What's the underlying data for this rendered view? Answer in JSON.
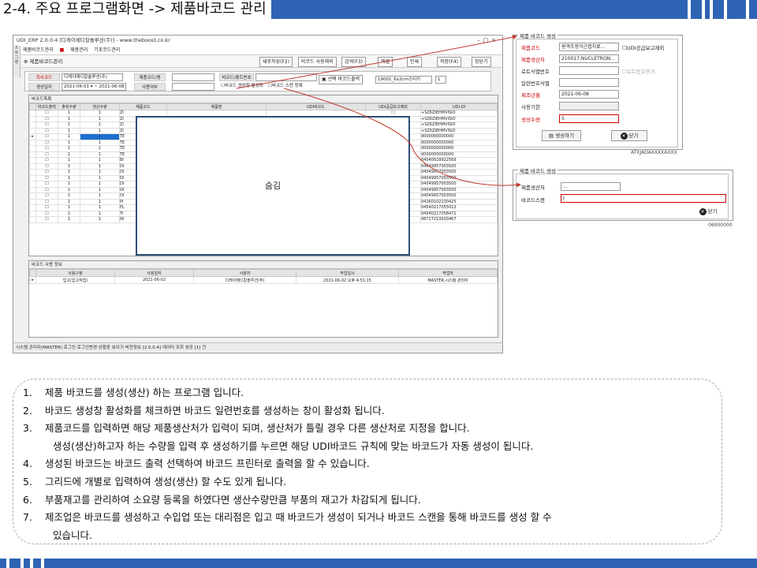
{
  "slide": {
    "title": "2-4. 주요 프로그램화면 -> 제품바코드 관리"
  },
  "window": {
    "title": "UDI_ERP 2.0.0.4 [디케이메디칼솔루션(주)] - www.theboost.co.kr",
    "menu": [
      "제품바코드관리",
      "제품관리",
      "기초코드관리"
    ],
    "side_tab": "프로그램",
    "page_title": "제품바코드관리",
    "toolbar": [
      "새로작성(F2)",
      "바코드 사용제외",
      "검색(F3)",
      "엑셀",
      "인쇄",
      "저장(F4)",
      "창닫기"
    ],
    "form": {
      "company_label": "회사코드",
      "company_value": "디케이메디칼솔루션(주)",
      "product_label": "제품코드/명",
      "barcode_label": "바코드/롯트번호",
      "date_label": "생성일자",
      "date_value": "2021-06-01 ▾ ~ 2021-06-08 ▾",
      "use_label": "사용여부",
      "chk1": "바코드 생성창 활성화",
      "chk2": "바코드 스캔 등록",
      "print_label": "선택 바코드출력",
      "print_value": "19001_6x2cm스티커",
      "print_count": "1"
    },
    "grid": {
      "caption": "바코드목록",
      "headers": [
        "",
        "바코드출력",
        "출력수량",
        "생산수량",
        "제품코드",
        "제품명",
        "UDI바코드",
        "UDI공급보고제외",
        "UDI-DI"
      ],
      "rows": [
        [
          "1",
          "1",
          "ZI",
          "+SZ6ZIEHMVISIO"
        ],
        [
          "1",
          "1",
          "ZI",
          "+SZ6ZIEHMVISIO"
        ],
        [
          "1",
          "1",
          "ZI",
          "+SZ6ZIEHMVISIO"
        ],
        [
          "1",
          "1",
          "ZI",
          "+SZ6ZIEHMVISIO"
        ],
        [
          "1",
          "1",
          "TE",
          "0000000000000"
        ],
        [
          "1",
          "1",
          "TE",
          "0000000000000"
        ],
        [
          "1",
          "1",
          "TE",
          "0000000000000"
        ],
        [
          "1",
          "1",
          "TE",
          "0000000000000"
        ],
        [
          "1",
          "1",
          "BI",
          "04040029922569"
        ],
        [
          "1",
          "1",
          "DI",
          "04049957003500"
        ],
        [
          "1",
          "1",
          "DI",
          "04049957003500"
        ],
        [
          "1",
          "1",
          "DI",
          "04049957003500"
        ],
        [
          "1",
          "1",
          "DI",
          "04049957003500"
        ],
        [
          "1",
          "1",
          "DI",
          "04049957003500"
        ],
        [
          "1",
          "1",
          "DI",
          "04049957003500"
        ],
        [
          "1",
          "1",
          "PI",
          "04260102130425"
        ],
        [
          "1",
          "1",
          "FL",
          "04540217055012"
        ],
        [
          "1",
          "1",
          "TI",
          "04540217058471"
        ],
        [
          "1",
          "1",
          "NI",
          "08717213020467"
        ]
      ]
    },
    "hidden_label": "숨김",
    "usage": {
      "caption": "바코드 사용 정보",
      "headers": [
        "",
        "사용구분",
        "사용일자",
        "사용처",
        "작업일시",
        "작업자"
      ],
      "row": [
        "입고(입고작업)",
        "2021-06-02",
        "디케이메디칼솔루션(주)",
        "2021-06-02 오후 4:51:15",
        "MASTER:시스템 관리자"
      ]
    },
    "status": "시스템 관리자(MASTER) 로그인  로그인변경  상황판 보이기  버전정보 [2.0.0.4]   데이터 조회 성공 [1] 건"
  },
  "create_dialog": {
    "title": "제품 바코드 생성",
    "product_label": "제품코드",
    "product_value": "원격조정식근접치료...",
    "exclude_check": "UDI공급보고제외",
    "maker_label": "제품생산처",
    "maker_value": "210017:NUCLETRON...",
    "lot_label": "로트식별번호",
    "lot_auto": "로트번호증가",
    "serial_label": "일련번호식별",
    "mfg_label": "제조년월",
    "mfg_value": "2021-06-08",
    "exp_label": "사용기한",
    "qty_label": "생성수량",
    "qty_value": "5",
    "create_btn": "생성하기",
    "close_btn": "닫기",
    "bg_text": "ATXJAOAXXXXAXXX"
  },
  "scan_dialog": {
    "title": "제품 바코드 생성",
    "maker_label": "제품생산처",
    "scan_label": "바코드스캔",
    "close_btn": "닫기",
    "bg_text": "…",
    "bg_num": "06000000"
  },
  "notes": [
    {
      "n": "1.",
      "text": "제품 바코드를 생성(생산) 하는 프로그램 입니다."
    },
    {
      "n": "2.",
      "text": "바코드 생성창 활성화를 체크하면 바코드 일련번호를 생성하는 창이 활성화 됩니다."
    },
    {
      "n": "3.",
      "text": "제품코드를 입력하면 해당 제품생산처가 입력이 되며, 생산처가 틀릴 경우 다른 생산처로 지정을 합니다."
    },
    {
      "n": "",
      "text": "생성(생산)하고자 하는 수량을 입력 후 생성하기를 누르면 해당 UDI바코드 규칙에 맞는 바코드가 자동 생성이 됩니다."
    },
    {
      "n": "4.",
      "text": "생성된 바코드는 바코드 출력 선택하여 바코드 프린터로 출력을 할 수 있습니다."
    },
    {
      "n": "5.",
      "text": "그리드에 개별로 입력하여 생성(생산) 할 수도 있게 됩니다."
    },
    {
      "n": "6.",
      "text": "부품재고를 관리하여 소요량 등록을 하였다면 생산수량만큼 부품의 재고가 차감되게 됩니다."
    },
    {
      "n": "7.",
      "text": "제조업은 바코드를 생성하고 수입업 또는 대리점은 입고 때 바코드가 생성이 되거나 바코드 스캔을 통해 바코드를 생성 할 수"
    },
    {
      "n": "",
      "text": "있습니다."
    }
  ],
  "colors": {
    "accent": "#2f64b4",
    "arrow": "#c0392b"
  }
}
